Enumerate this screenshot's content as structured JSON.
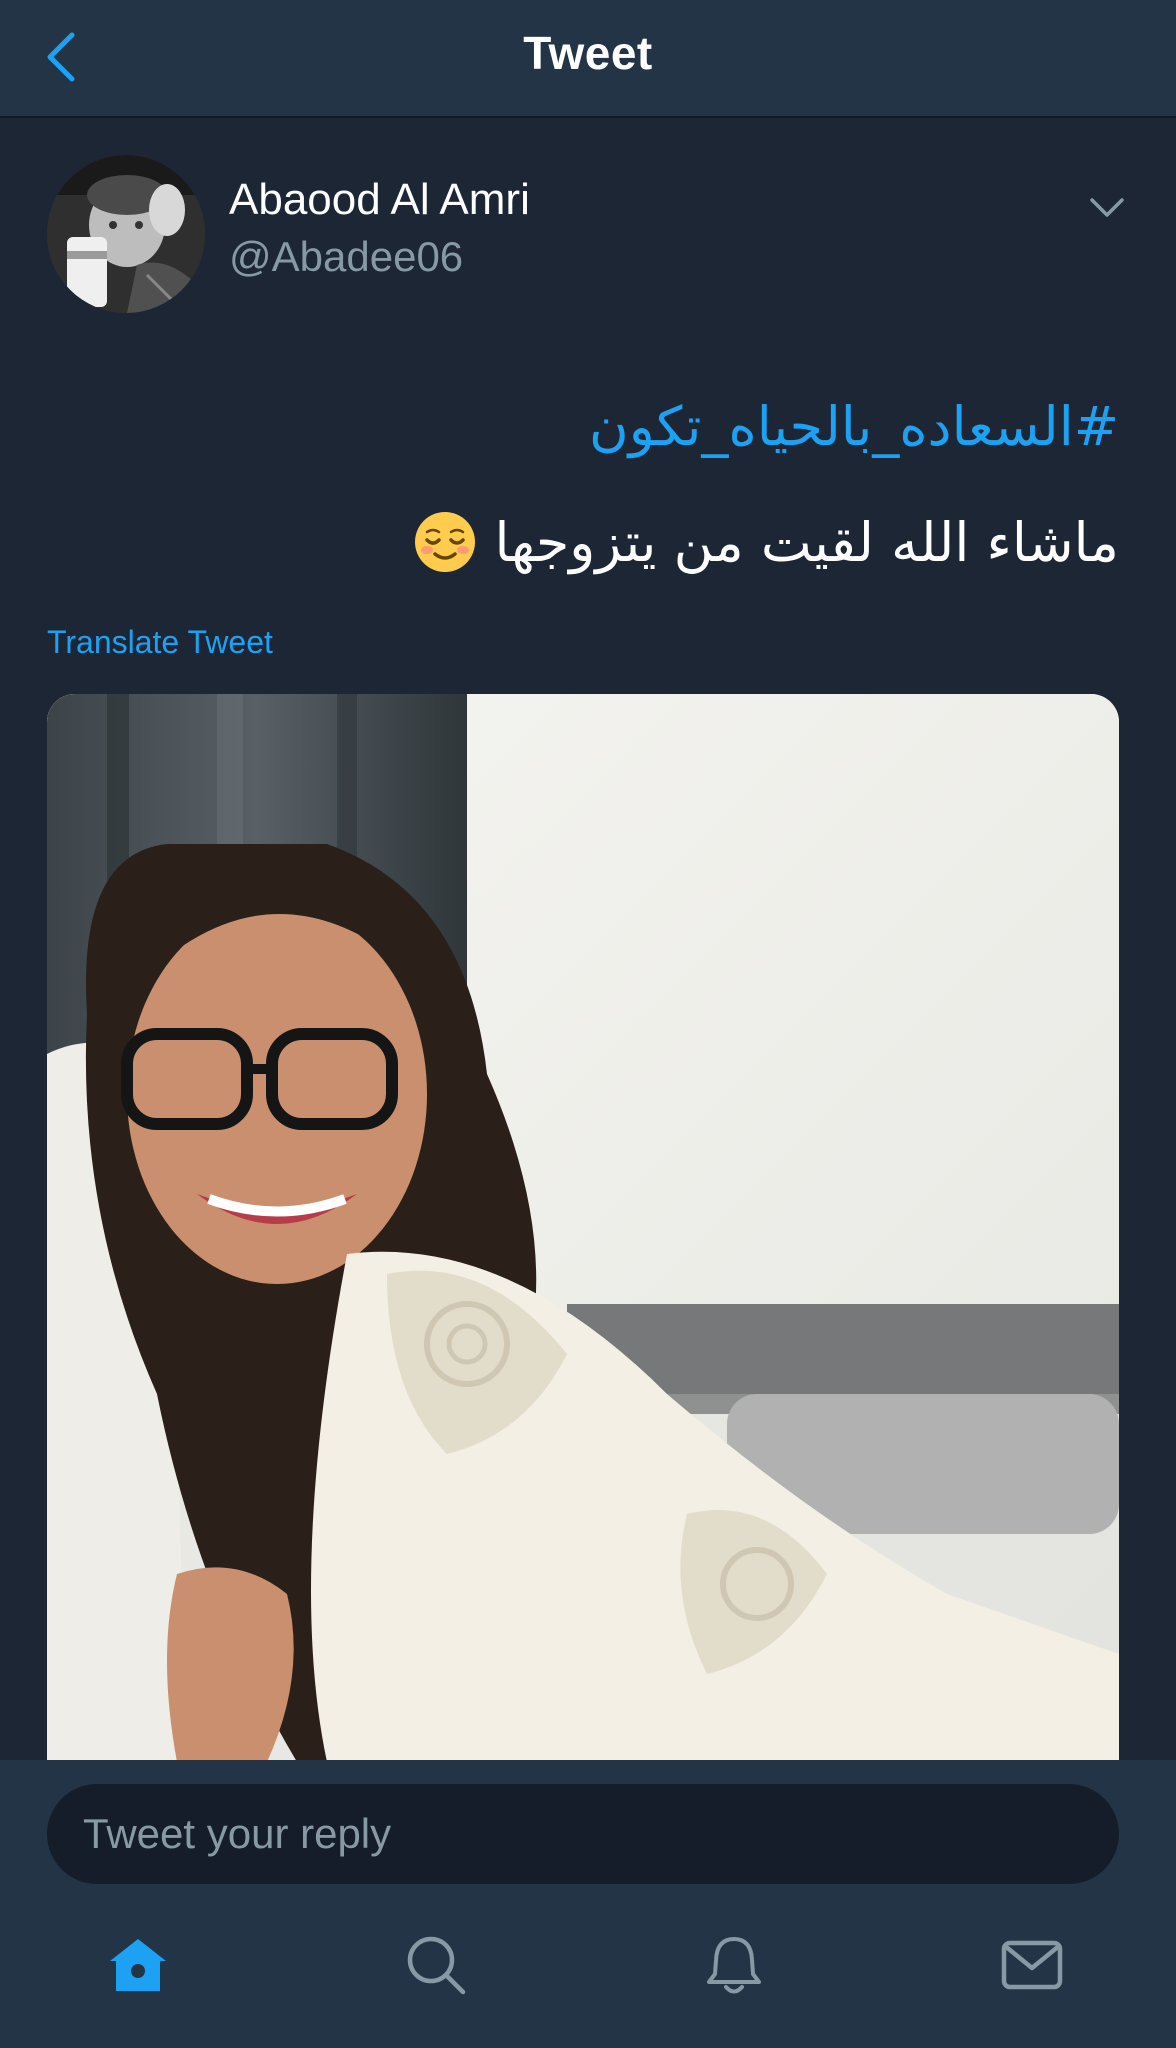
{
  "header": {
    "title": "Tweet",
    "back_icon": "chevron-left-icon"
  },
  "tweet": {
    "author_name": "Abaood Al Amri",
    "author_handle": "@Abadee06",
    "hashtag": "#السعاده_بالحياه_تكون",
    "text": "ماشاء الله لقيت من يتزوجها",
    "emoji": "relieved-face-emoji",
    "translate_label": "Translate Tweet"
  },
  "reply": {
    "placeholder": "Tweet your reply"
  },
  "tabbar": {
    "items": [
      "home-icon",
      "search-icon",
      "notifications-icon",
      "messages-icon"
    ],
    "active": "home-icon"
  },
  "colors": {
    "background": "#1c2635",
    "bar": "#243447",
    "accent": "#1da1f2",
    "muted": "#8899a6"
  }
}
